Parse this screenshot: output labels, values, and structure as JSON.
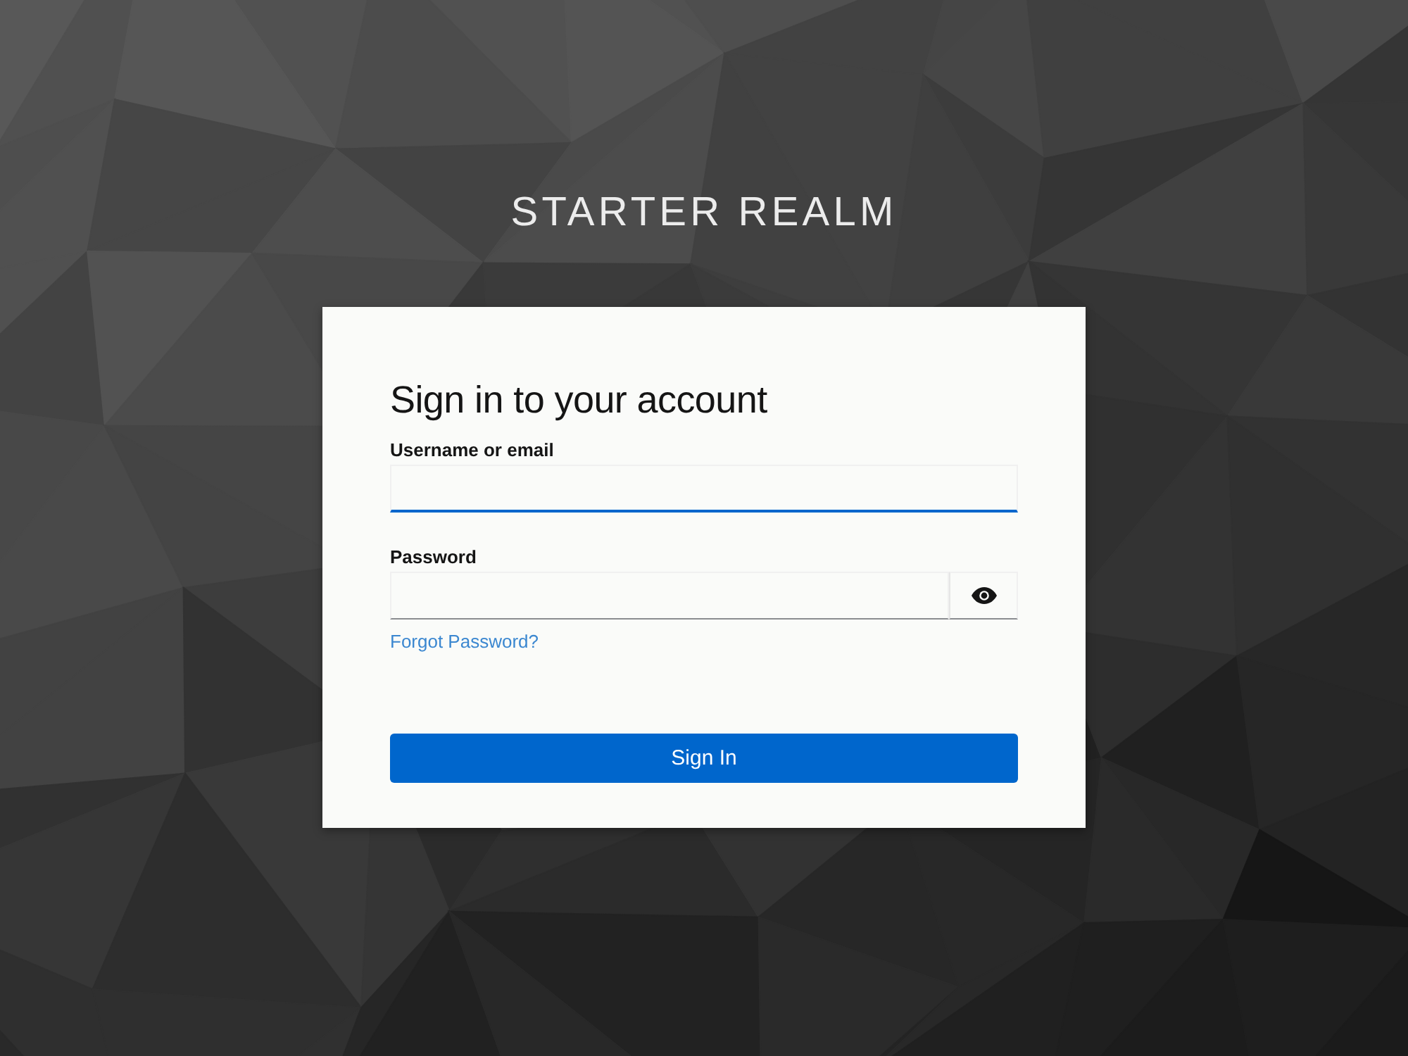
{
  "realm_title": "STARTER REALM",
  "card": {
    "heading": "Sign in to your account",
    "fields": [
      {
        "kind": "text",
        "label": "Username or email",
        "focused": true
      },
      {
        "kind": "password",
        "label": "Password",
        "focused": false
      }
    ],
    "forgot_link": "Forgot Password?",
    "submit_button": "Sign In"
  }
}
